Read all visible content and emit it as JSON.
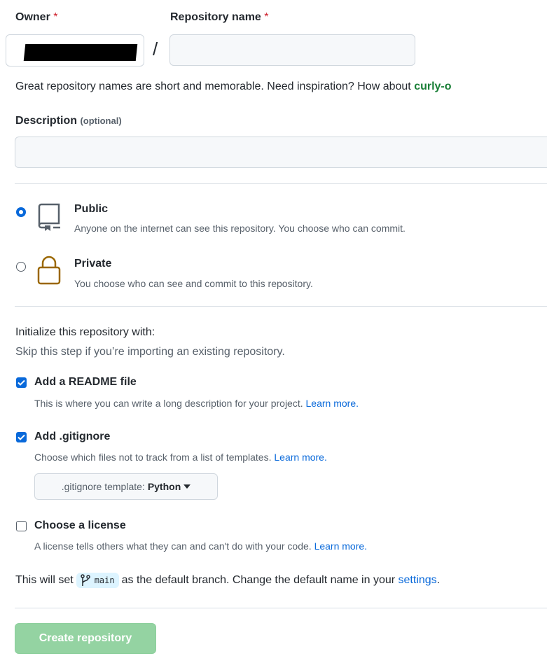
{
  "owner": {
    "label": "Owner",
    "required_mark": "*"
  },
  "repo_name": {
    "label": "Repository name",
    "required_mark": "*",
    "value": "",
    "placeholder": ""
  },
  "separator": "/",
  "name_hint": {
    "text": "Great repository names are short and memorable. Need inspiration? How about ",
    "suggestion": "curly-o"
  },
  "description": {
    "label": "Description",
    "optional": "(optional)",
    "value": ""
  },
  "visibility": {
    "public": {
      "title": "Public",
      "desc": "Anyone on the internet can see this repository. You choose who can commit.",
      "selected": true,
      "icon": "repo-icon"
    },
    "private": {
      "title": "Private",
      "desc": "You choose who can see and commit to this repository.",
      "selected": false,
      "icon": "lock-icon"
    }
  },
  "init": {
    "title": "Initialize this repository with:",
    "subtitle": "Skip this step if you’re importing an existing repository.",
    "readme": {
      "label": "Add a README file",
      "desc": "This is where you can write a long description for your project.",
      "link": "Learn more.",
      "checked": true
    },
    "gitignore": {
      "label": "Add .gitignore",
      "desc": "Choose which files not to track from a list of templates.",
      "link": "Learn more.",
      "checked": true,
      "select_prefix": ".gitignore template:",
      "select_value": "Python"
    },
    "license": {
      "label": "Choose a license",
      "desc": "A license tells others what they can and can't do with your code.",
      "link": "Learn more.",
      "checked": false
    }
  },
  "branch": {
    "pre": "This will set",
    "name": "main",
    "post": "as the default branch. Change the default name in your",
    "link": "settings",
    "end": "."
  },
  "create_button": "Create repository",
  "colors": {
    "accent": "#0969da",
    "success_disabled": "#94d3a2",
    "required": "#cf222e",
    "suggestion": "#1a7f37"
  }
}
